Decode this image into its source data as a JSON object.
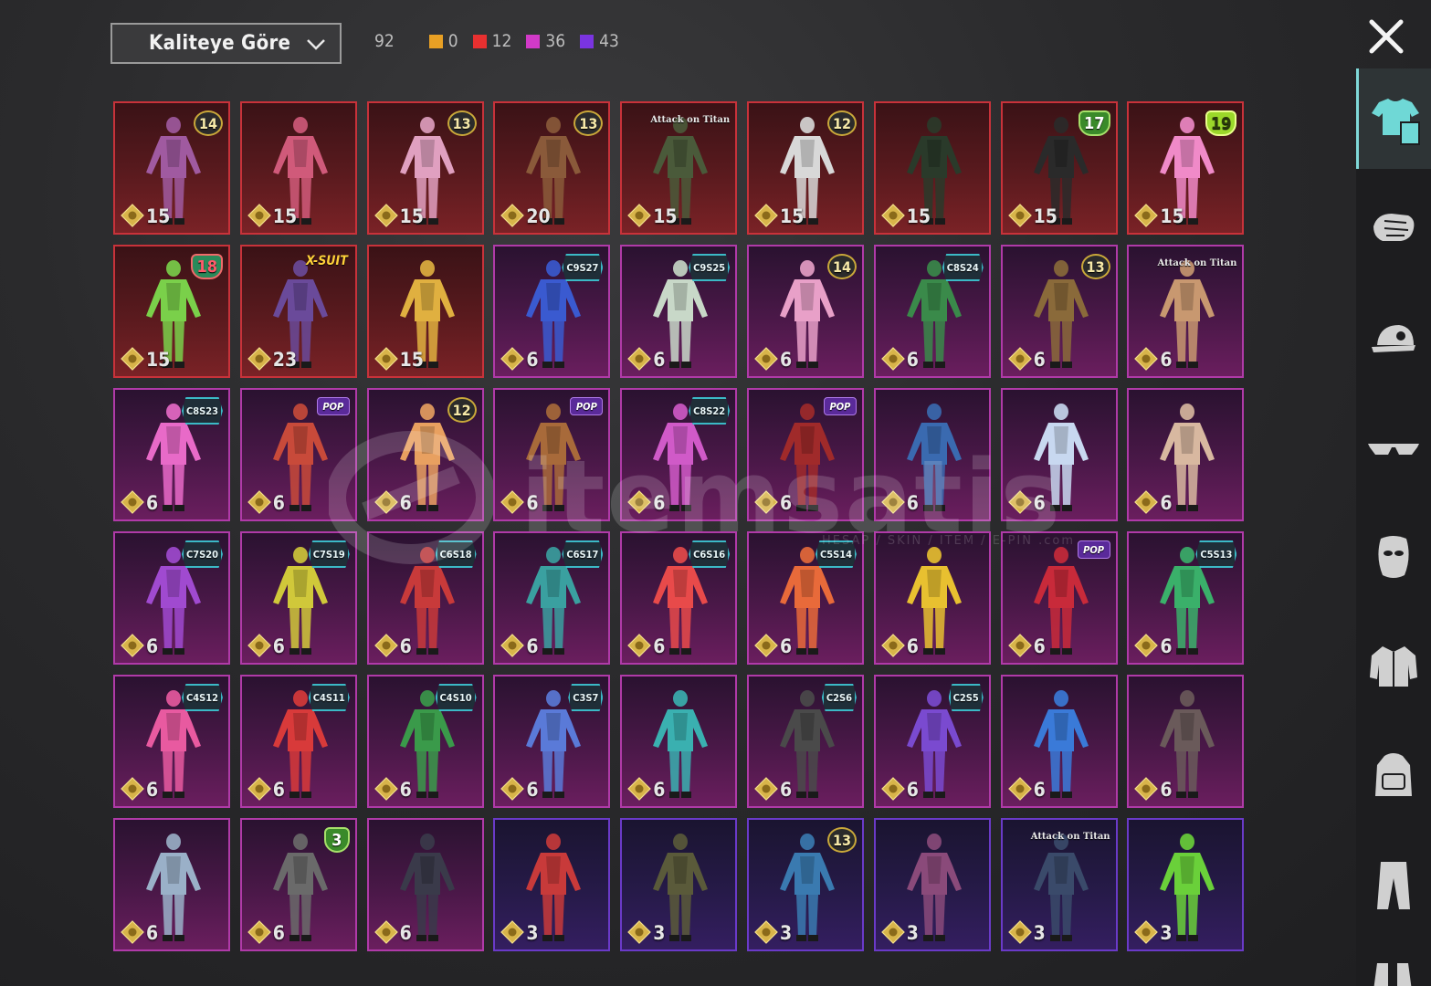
{
  "toolbar": {
    "sort_label": "Kaliteye Göre",
    "total": "92",
    "counts": [
      {
        "color": "#e8a024",
        "value": "0"
      },
      {
        "color": "#e83030",
        "value": "12"
      },
      {
        "color": "#d23ac8",
        "value": "36"
      },
      {
        "color": "#7a34e0",
        "value": "43"
      }
    ]
  },
  "watermark": {
    "text": "itemsatis",
    "sub": "HESAP / SKIN / ITEM / E-PIN .com"
  },
  "cards": [
    {
      "rarity": "legendary",
      "badge": "14",
      "badge_type": "num",
      "qty": "15",
      "hue": "#a05aa0"
    },
    {
      "rarity": "legendary",
      "badge": "",
      "badge_type": "",
      "qty": "15",
      "hue": "#d05a7a"
    },
    {
      "rarity": "legendary",
      "badge": "13",
      "badge_type": "num",
      "qty": "15",
      "hue": "#e0a0c0"
    },
    {
      "rarity": "legendary",
      "badge": "13",
      "badge_type": "num",
      "qty": "20",
      "hue": "#8a5a3a"
    },
    {
      "rarity": "legendary",
      "badge": "Attack on Titan",
      "badge_type": "logo",
      "qty": "15",
      "hue": "#4a5a3a"
    },
    {
      "rarity": "legendary",
      "badge": "12",
      "badge_type": "num",
      "qty": "15",
      "hue": "#d8d8d8"
    },
    {
      "rarity": "legendary",
      "badge": "",
      "badge_type": "",
      "qty": "15",
      "hue": "#2a3a2a"
    },
    {
      "rarity": "legendary",
      "badge": "17",
      "badge_type": "shield-green",
      "qty": "15",
      "hue": "#2a2a2a"
    },
    {
      "rarity": "legendary",
      "badge": "19",
      "badge_type": "shield-lime",
      "qty": "15",
      "hue": "#f08ac8"
    },
    {
      "rarity": "legendary",
      "badge": "18",
      "badge_type": "shield-red",
      "qty": "15",
      "hue": "#7ad04a"
    },
    {
      "rarity": "legendary",
      "badge": "X-SUIT",
      "badge_type": "text",
      "qty": "23",
      "hue": "#6a4a9a"
    },
    {
      "rarity": "legendary",
      "badge": "",
      "badge_type": "",
      "qty": "15",
      "hue": "#e0b040"
    },
    {
      "rarity": "mythic",
      "badge": "C9S27",
      "badge_type": "season",
      "qty": "6",
      "hue": "#3a5ad0"
    },
    {
      "rarity": "mythic",
      "badge": "C9S25",
      "badge_type": "season",
      "qty": "6",
      "hue": "#c8d8c8"
    },
    {
      "rarity": "mythic",
      "badge": "14",
      "badge_type": "num",
      "qty": "6",
      "hue": "#e8a0c8"
    },
    {
      "rarity": "mythic",
      "badge": "C8S24",
      "badge_type": "season",
      "qty": "6",
      "hue": "#3a8a4a"
    },
    {
      "rarity": "mythic",
      "badge": "13",
      "badge_type": "num",
      "qty": "6",
      "hue": "#8a6a3a"
    },
    {
      "rarity": "mythic",
      "badge": "Attack on Titan",
      "badge_type": "logo",
      "qty": "6",
      "hue": "#c89870"
    },
    {
      "rarity": "mythic",
      "badge": "C8S23",
      "badge_type": "season",
      "qty": "6",
      "hue": "#e86ac8"
    },
    {
      "rarity": "mythic",
      "badge": "POP",
      "badge_type": "pop",
      "qty": "6",
      "hue": "#c84a3a"
    },
    {
      "rarity": "mythic",
      "badge": "12",
      "badge_type": "num",
      "qty": "6",
      "hue": "#e8a060"
    },
    {
      "rarity": "mythic",
      "badge": "POP",
      "badge_type": "pop",
      "qty": "6",
      "hue": "#a86a3a"
    },
    {
      "rarity": "mythic",
      "badge": "C8S22",
      "badge_type": "season",
      "qty": "6",
      "hue": "#d05ac8"
    },
    {
      "rarity": "mythic",
      "badge": "POP",
      "badge_type": "pop",
      "qty": "6",
      "hue": "#a02a2a"
    },
    {
      "rarity": "mythic",
      "badge": "",
      "badge_type": "",
      "qty": "6",
      "hue": "#3a6ab0"
    },
    {
      "rarity": "mythic",
      "badge": "",
      "badge_type": "",
      "qty": "6",
      "hue": "#c8d8f0"
    },
    {
      "rarity": "mythic",
      "badge": "",
      "badge_type": "",
      "qty": "6",
      "hue": "#d8b8a0"
    },
    {
      "rarity": "mythic",
      "badge": "C7S20",
      "badge_type": "season",
      "qty": "6",
      "hue": "#a04ad0"
    },
    {
      "rarity": "mythic",
      "badge": "C7S19",
      "badge_type": "season",
      "qty": "6",
      "hue": "#d0c83a"
    },
    {
      "rarity": "mythic",
      "badge": "C6S18",
      "badge_type": "season",
      "qty": "6",
      "hue": "#c83a3a"
    },
    {
      "rarity": "mythic",
      "badge": "C6S17",
      "badge_type": "season",
      "qty": "6",
      "hue": "#3aa0a0"
    },
    {
      "rarity": "mythic",
      "badge": "C6S16",
      "badge_type": "season",
      "qty": "6",
      "hue": "#e84a4a"
    },
    {
      "rarity": "mythic",
      "badge": "C5S14",
      "badge_type": "season",
      "qty": "6",
      "hue": "#e86a3a"
    },
    {
      "rarity": "mythic",
      "badge": "",
      "badge_type": "",
      "qty": "6",
      "hue": "#e8c030"
    },
    {
      "rarity": "mythic",
      "badge": "POP",
      "badge_type": "pop",
      "qty": "6",
      "hue": "#c82a3a"
    },
    {
      "rarity": "mythic",
      "badge": "C5S13",
      "badge_type": "season",
      "qty": "6",
      "hue": "#3ab06a"
    },
    {
      "rarity": "mythic",
      "badge": "C4S12",
      "badge_type": "season",
      "qty": "6",
      "hue": "#e85aa0"
    },
    {
      "rarity": "mythic",
      "badge": "C4S11",
      "badge_type": "season",
      "qty": "6",
      "hue": "#d83a3a"
    },
    {
      "rarity": "mythic",
      "badge": "C4S10",
      "badge_type": "season",
      "qty": "6",
      "hue": "#3a9a4a"
    },
    {
      "rarity": "mythic",
      "badge": "C3S7",
      "badge_type": "season",
      "qty": "6",
      "hue": "#5a7ad8"
    },
    {
      "rarity": "mythic",
      "badge": "",
      "badge_type": "",
      "qty": "6",
      "hue": "#3ab0b0"
    },
    {
      "rarity": "mythic",
      "badge": "C2S6",
      "badge_type": "season",
      "qty": "6",
      "hue": "#4a4a4a"
    },
    {
      "rarity": "mythic",
      "badge": "C2S5",
      "badge_type": "season",
      "qty": "6",
      "hue": "#7a4ad0"
    },
    {
      "rarity": "mythic",
      "badge": "",
      "badge_type": "",
      "qty": "6",
      "hue": "#3a7ad8"
    },
    {
      "rarity": "mythic",
      "badge": "",
      "badge_type": "",
      "qty": "6",
      "hue": "#6a5a5a"
    },
    {
      "rarity": "mythic",
      "badge": "",
      "badge_type": "",
      "qty": "6",
      "hue": "#9ab0c8"
    },
    {
      "rarity": "mythic",
      "badge": "3",
      "badge_type": "shield-green",
      "qty": "6",
      "hue": "#6a6a6a"
    },
    {
      "rarity": "mythic",
      "badge": "",
      "badge_type": "",
      "qty": "6",
      "hue": "#3a3a4a"
    },
    {
      "rarity": "epic",
      "badge": "",
      "badge_type": "",
      "qty": "3",
      "hue": "#c83a3a"
    },
    {
      "rarity": "epic",
      "badge": "",
      "badge_type": "",
      "qty": "3",
      "hue": "#5a5a3a"
    },
    {
      "rarity": "epic",
      "badge": "13",
      "badge_type": "num",
      "qty": "3",
      "hue": "#3a7ab0"
    },
    {
      "rarity": "epic",
      "badge": "",
      "badge_type": "",
      "qty": "3",
      "hue": "#8a4a7a"
    },
    {
      "rarity": "epic",
      "badge": "Attack on Titan",
      "badge_type": "logo",
      "qty": "3",
      "hue": "#3a4a6a"
    },
    {
      "rarity": "epic",
      "badge": "",
      "badge_type": "",
      "qty": "3",
      "hue": "#6ad03a"
    }
  ],
  "sidebar": {
    "tabs": [
      {
        "name": "outfits",
        "icon": "outfit-icon",
        "active": true
      },
      {
        "name": "emotes",
        "icon": "fist-icon",
        "active": false
      },
      {
        "name": "hats",
        "icon": "cap-icon",
        "active": false
      },
      {
        "name": "glasses",
        "icon": "glasses-icon",
        "active": false
      },
      {
        "name": "masks",
        "icon": "mask-icon",
        "active": false
      },
      {
        "name": "tops",
        "icon": "jacket-icon",
        "active": false
      },
      {
        "name": "backpacks",
        "icon": "backpack-icon",
        "active": false
      },
      {
        "name": "pants",
        "icon": "pants-icon",
        "active": false
      },
      {
        "name": "shoes",
        "icon": "shoes-icon",
        "active": false
      }
    ]
  }
}
